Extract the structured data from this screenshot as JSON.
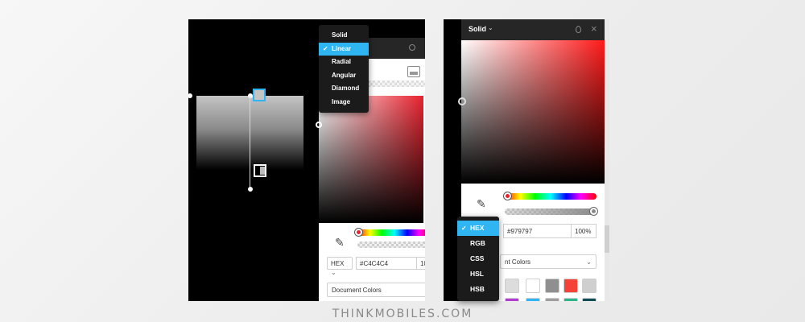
{
  "left_shot": {
    "fill_type_menu": [
      {
        "label": "Solid",
        "selected": false
      },
      {
        "label": "Linear",
        "selected": true
      },
      {
        "label": "Radial",
        "selected": false
      },
      {
        "label": "Angular",
        "selected": false
      },
      {
        "label": "Diamond",
        "selected": false
      },
      {
        "label": "Image",
        "selected": false
      }
    ],
    "format": "HEX",
    "hex_value": "#C4C4C4",
    "opacity_partial": "10",
    "library": "Document Colors"
  },
  "right_shot": {
    "header_title": "Solid",
    "header_dropdown": "⌄",
    "close_glyph": "×",
    "format_menu": [
      {
        "label": "HEX",
        "selected": true
      },
      {
        "label": "RGB",
        "selected": false
      },
      {
        "label": "CSS",
        "selected": false
      },
      {
        "label": "HSL",
        "selected": false
      },
      {
        "label": "HSB",
        "selected": false
      }
    ],
    "hex_value": "#979797",
    "opacity": "100%",
    "library_partial": "nt Colors",
    "swatches_row1": [
      "#dcdcdc",
      "#ffffff",
      "#8f8f8f",
      "#f44336",
      "#cfcfcf"
    ],
    "swatches_row2": [
      "#b23bd2",
      "#2fb6f2",
      "#9e9e9e",
      "#2ab58a",
      "#0f4c54",
      "#111111"
    ]
  },
  "colors": {
    "accent": "#2fb6f2",
    "menu_bg": "#1b1b1b",
    "panel_header": "#262626"
  },
  "icons": {
    "eyedropper": "eyedropper-icon",
    "checkmark": "check-icon",
    "chevron": "chevron-down-icon"
  },
  "footer": {
    "text": "THINKMOBILES.COM"
  }
}
